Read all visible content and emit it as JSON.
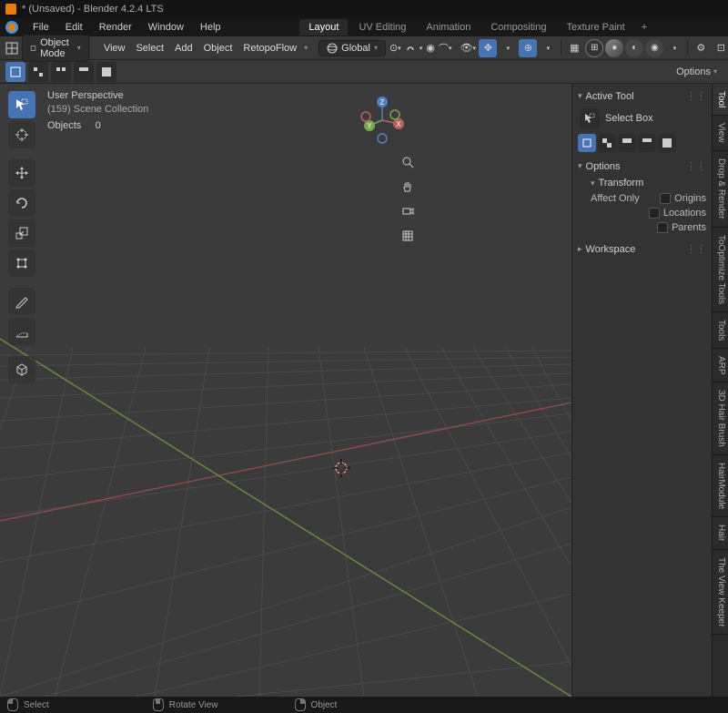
{
  "titlebar": {
    "title": "* (Unsaved) - Blender 4.2.4 LTS"
  },
  "topmenu": {
    "items": [
      "File",
      "Edit",
      "Render",
      "Window",
      "Help"
    ],
    "tabs": [
      "Layout",
      "UV Editing",
      "Animation",
      "Compositing",
      "Texture Paint"
    ],
    "active_tab": 0
  },
  "header": {
    "mode": "Object Mode",
    "menus": [
      "View",
      "Select",
      "Add",
      "Object",
      "RetopoFlow"
    ],
    "orientation": "Global"
  },
  "selmode": {
    "options_label": "Options"
  },
  "viewport": {
    "perspective": "User Perspective",
    "collection": "(159) Scene Collection",
    "stats_label": "Objects",
    "stats_value": "0"
  },
  "gizmo": {
    "axes": {
      "x": "X",
      "y": "Y",
      "z": "Z"
    }
  },
  "npanel": {
    "active_tool_head": "Active Tool",
    "tool_name": "Select Box",
    "options_head": "Options",
    "transform_head": "Transform",
    "affect_only": "Affect Only",
    "fields": [
      "Origins",
      "Locations",
      "Parents"
    ],
    "workspace_head": "Workspace"
  },
  "right_tabs": [
    "Tool",
    "View",
    "Drop & Render",
    "ToOptimize Tools",
    "Tools",
    "ARP",
    "3D Hair Brush",
    "HairModule",
    "Hair",
    "The View Keeper"
  ],
  "statusbar": {
    "hints": [
      "Select",
      "Rotate View",
      "Object"
    ]
  },
  "colors": {
    "axis_x": "#b55f5f",
    "axis_y": "#7aa64e",
    "axis_z": "#4f7fbf",
    "accent": "#4772b3"
  }
}
